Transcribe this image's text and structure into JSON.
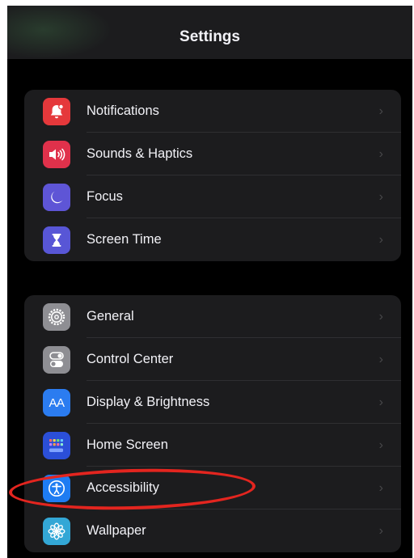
{
  "header": {
    "title": "Settings"
  },
  "groups": [
    {
      "items": [
        {
          "label": "Notifications",
          "icon": "bell-icon",
          "color": "#e5383b"
        },
        {
          "label": "Sounds & Haptics",
          "icon": "speaker-icon",
          "color": "#e0314b"
        },
        {
          "label": "Focus",
          "icon": "moon-icon",
          "color": "#5e55d6"
        },
        {
          "label": "Screen Time",
          "icon": "hourglass-icon",
          "color": "#5856d6"
        }
      ]
    },
    {
      "items": [
        {
          "label": "General",
          "icon": "gear-icon",
          "color": "#8e8e93"
        },
        {
          "label": "Control Center",
          "icon": "toggles-icon",
          "color": "#8e8e93"
        },
        {
          "label": "Display & Brightness",
          "icon_text": "AA",
          "icon": "text-size-icon",
          "color": "#2b7cf0"
        },
        {
          "label": "Home Screen",
          "icon": "app-grid-icon",
          "color": "#2b4fd8"
        },
        {
          "label": "Accessibility",
          "icon": "accessibility-icon",
          "color": "#1e7cf2"
        },
        {
          "label": "Wallpaper",
          "icon": "flower-icon",
          "color": "#33a7d6"
        }
      ]
    }
  ],
  "chevron": "›",
  "annotation": {
    "type": "ellipse",
    "color": "#e3251f",
    "target": "Accessibility"
  }
}
